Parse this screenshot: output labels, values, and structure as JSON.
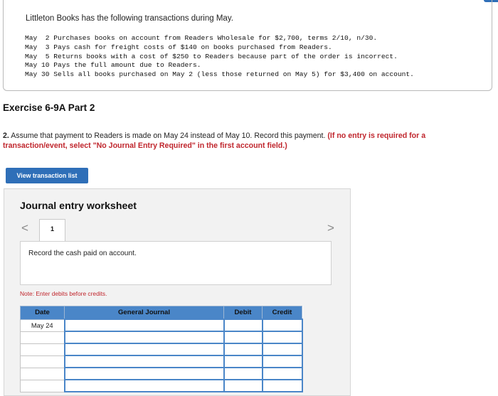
{
  "problem": {
    "intro": "Littleton Books has the following transactions during May.",
    "transactions": [
      "May  2 Purchases books on account from Readers Wholesale for $2,700, terms 2/10, n/30.",
      "May  3 Pays cash for freight costs of $140 on books purchased from Readers.",
      "May  5 Returns books with a cost of $250 to Readers because part of the order is incorrect.",
      "May 10 Pays the full amount due to Readers.",
      "May 30 Sells all books purchased on May 2 (less those returned on May 5) for $3,400 on account."
    ]
  },
  "exercise": {
    "title": "Exercise 6-9A Part 2"
  },
  "question": {
    "number": "2.",
    "text": " Assume that payment to Readers is made on May 24 instead of May 10. Record this payment. ",
    "instruction": "(If no entry is required for a transaction/event, select \"No Journal Entry Required\" in the first account field.)"
  },
  "view_button": {
    "label": "View transaction list"
  },
  "worksheet": {
    "title": "Journal entry worksheet",
    "prev_icon": "chevron-left-icon",
    "next_icon": "chevron-right-icon",
    "prev_glyph": "<",
    "next_glyph": ">",
    "tab_number": "1",
    "record_instruction": "Record the cash paid on account.",
    "note": "Note: Enter debits before credits.",
    "table": {
      "headers": {
        "date": "Date",
        "account": "General Journal",
        "debit": "Debit",
        "credit": "Credit"
      },
      "rows": [
        {
          "date": "May 24",
          "account": "",
          "debit": "",
          "credit": ""
        },
        {
          "date": "",
          "account": "",
          "debit": "",
          "credit": ""
        },
        {
          "date": "",
          "account": "",
          "debit": "",
          "credit": ""
        },
        {
          "date": "",
          "account": "",
          "debit": "",
          "credit": ""
        },
        {
          "date": "",
          "account": "",
          "debit": "",
          "credit": ""
        },
        {
          "date": "",
          "account": "",
          "debit": "",
          "credit": ""
        }
      ]
    }
  },
  "colors": {
    "accent": "#2f6fb8",
    "header": "#4a86c8",
    "warning": "#c0262d"
  }
}
